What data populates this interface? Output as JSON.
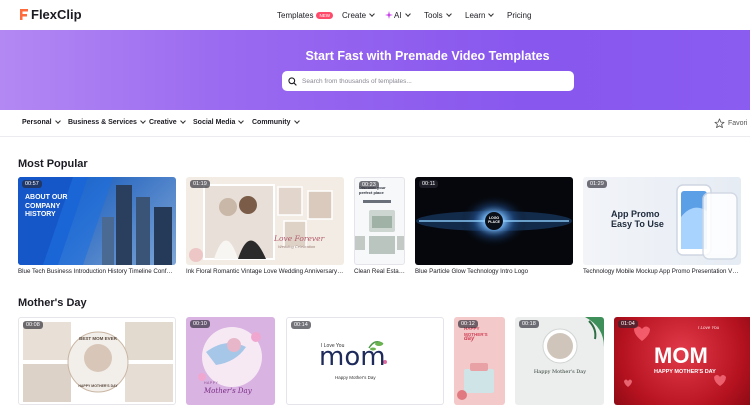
{
  "brand": {
    "name": "FlexClip",
    "color": "#1b1b23",
    "accent": "#ff6a3d"
  },
  "nav": {
    "templates": "Templates",
    "new_badge": "NEW",
    "create": "Create",
    "ai": "AI",
    "tools": "Tools",
    "learn": "Learn",
    "pricing": "Pricing"
  },
  "hero": {
    "title": "Start Fast with Premade Video Templates",
    "search_placeholder": "Search from thousands of templates...",
    "colors": [
      "#b388f3",
      "#8857ee"
    ]
  },
  "categories": [
    "Personal",
    "Business & Services",
    "Creative",
    "Social Media",
    "Community"
  ],
  "favorites": "Favori",
  "sections": [
    {
      "title": "Most Popular",
      "items": [
        {
          "duration": "00:57",
          "caption": "Blue Tech Business Introduction History Timeline Conf…",
          "text": [
            "ABOUT OUR",
            "COMPANY",
            "HISTORY"
          ]
        },
        {
          "duration": "01:19",
          "caption": "Ink Floral Romantic Vintage Love Wedding Anniversary …",
          "text": [
            "Love Forever",
            "Wedding Celebration"
          ]
        },
        {
          "duration": "00:23",
          "caption": "Clean Real Estat…",
          "text": [
            "Discover your",
            "perfect place"
          ]
        },
        {
          "duration": "00:11",
          "caption": "Blue Particle Glow Technology Intro Logo",
          "text": [
            "LOGO",
            "PLACE"
          ]
        },
        {
          "duration": "01:29",
          "caption": "Technology Mobile Mockup App Promo Presentation V…",
          "text": [
            "App Promo",
            "Easy To Use"
          ]
        }
      ]
    },
    {
      "title": "Mother's Day",
      "items": [
        {
          "duration": "00:08",
          "text": [
            "BEST MOM EVER",
            "HAPPY MOTHER'S DAY"
          ]
        },
        {
          "duration": "00:10",
          "text": [
            "HAPPY",
            "Mother's Day"
          ]
        },
        {
          "duration": "00:14",
          "text": [
            "I Love You",
            "mom",
            "Happy Mother's Day"
          ]
        },
        {
          "duration": "00:12",
          "text": [
            "HAPPY",
            "MOTHER'S",
            "day"
          ]
        },
        {
          "duration": "00:18",
          "text": [
            "Happy Mother's Day"
          ]
        },
        {
          "duration": "01:04",
          "text": [
            "I Love You",
            "MOM",
            "HAPPY MOTHER'S DAY"
          ]
        }
      ]
    }
  ]
}
